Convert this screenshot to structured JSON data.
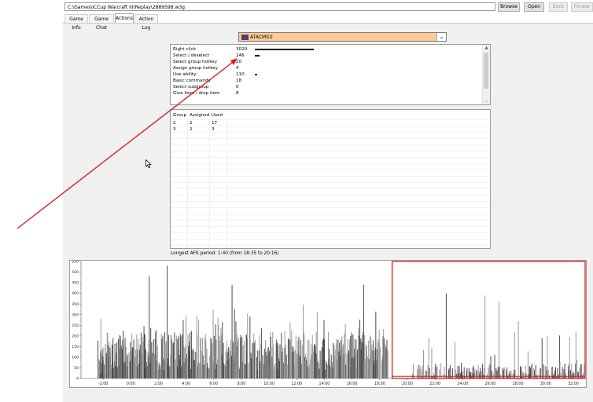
{
  "toolbar": {
    "path": "C:\\Games\\ICCup Warcraft III\\Replay\\2889598.w3g",
    "browse_label": "Browse",
    "open_label": "Open",
    "back_label": "Back",
    "forward_label": "Forwar"
  },
  "tabs": [
    {
      "label": "Game Info",
      "active": false
    },
    {
      "label": "Game Chat",
      "active": false
    },
    {
      "label": "Actions",
      "active": true
    },
    {
      "label": "Action Log",
      "active": false
    }
  ],
  "player_select": {
    "selected": "ATACMS))",
    "background": "#fdcc95"
  },
  "actions": {
    "rows": [
      {
        "label": "Right click",
        "count": "3020",
        "bar_fraction": 1.0
      },
      {
        "label": "Select / deselect",
        "count": "246",
        "bar_fraction": 0.08
      },
      {
        "label": "Select group hotkey",
        "count": "20",
        "bar_fraction": 0
      },
      {
        "label": "Assign group hotkey",
        "count": "4",
        "bar_fraction": 0
      },
      {
        "label": "Use ability",
        "count": "110",
        "bar_fraction": 0.035
      },
      {
        "label": "Basic commands",
        "count": "18",
        "bar_fraction": 0
      },
      {
        "label": "Select subgroup",
        "count": "0",
        "bar_fraction": 0
      },
      {
        "label": "Give item / drop item",
        "count": "8",
        "bar_fraction": 0
      }
    ]
  },
  "groups": {
    "headers": [
      "Group",
      "Assigned",
      "Used"
    ],
    "rows": [
      [
        "2",
        "2",
        "17"
      ],
      [
        "3",
        "2",
        "3"
      ]
    ]
  },
  "afk_text": "Longest AFK period: 1:40 (from 18:35 to 20:16)",
  "colors": {
    "highlight_red": "#d42020",
    "bar_dark": "#4a4a4a",
    "bar_light": "#9a9a9a"
  },
  "chart_data": {
    "type": "bar",
    "xlabel": "",
    "ylabel": "",
    "x_ticks": [
      "-2:00",
      "0:00",
      "2:00",
      "4:00",
      "6:00",
      "8:00",
      "10:00",
      "12:00",
      "14:00",
      "16:00",
      "18:00",
      "20:00",
      "22:00",
      "24:00",
      "26:00",
      "28:00",
      "30:00",
      "32:00"
    ],
    "y_ticks": [
      "0",
      "50",
      "100",
      "150",
      "200",
      "250",
      "300",
      "350",
      "400",
      "450",
      "500",
      "550"
    ],
    "ylim": [
      0,
      550
    ],
    "x_range_minutes": [
      -3.6,
      32.8
    ],
    "segments": [
      {
        "from": -2.4,
        "to": 18.6,
        "level": "high"
      },
      {
        "from": 18.6,
        "to": 20.3,
        "level": "none"
      },
      {
        "from": 20.3,
        "to": 32.8,
        "level": "low"
      }
    ],
    "peaks": [
      {
        "minute": 2.6,
        "value": 530
      },
      {
        "minute": 7.3,
        "value": 440
      },
      {
        "minute": 1.3,
        "value": 480
      },
      {
        "minute": 16.8,
        "value": 440
      },
      {
        "minute": 22.8,
        "value": 400
      },
      {
        "minute": 25.6,
        "value": 390
      },
      {
        "minute": 26.6,
        "value": 360
      },
      {
        "minute": 28.0,
        "value": 270
      },
      {
        "minute": 30.1,
        "value": 200
      }
    ],
    "grid": false,
    "legend": "none"
  },
  "annotations": {
    "highlight_box_label": "",
    "arrow_target": "Select group hotkey count"
  }
}
